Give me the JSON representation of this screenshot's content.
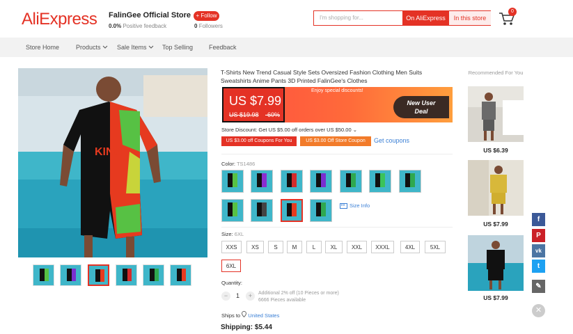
{
  "header": {
    "logo": "AliExpress",
    "store_name": "FalinGee Official Store",
    "store_name_chevron": "⌄",
    "feedback_value": "0.0%",
    "feedback_label": "Positive feedback",
    "follow_label": "+ Follow",
    "followers_value": "0",
    "followers_label": "Followers",
    "search_placeholder": "I'm shopping for...",
    "search_ali_label": "On AliExpress",
    "search_store_label": "In this store",
    "cart_count": "0"
  },
  "nav": {
    "items": [
      "Store Home",
      "Products",
      "Sale Items",
      "Top Selling",
      "Feedback"
    ]
  },
  "product": {
    "title": "T-Shirts New Trend Casual Style Sets Oversized Fashion Clothing Men Suits Sweatshirts Anime Pants 3D Printed FalinGee's Clothes",
    "price_now": "US $7.99",
    "price_old": "US $19.98",
    "discount": "-60%",
    "promo_text": "Enjoy special discounts!",
    "new_user_line1": "New User",
    "new_user_line2": "Deal",
    "store_discount": "Store Discount: Get US $5.00 off orders over US $50.00 ⌄",
    "coupon1": "US $3.00 off Coupons For You",
    "coupon2": "US $3.00 Off Store Coupon",
    "get_coupons": "Get coupons",
    "color_label": "Color:",
    "color_value": "TS1486",
    "size_info": "Size Info",
    "size_label": "Size:",
    "size_value": "6XL",
    "sizes": [
      "XXS",
      "XS",
      "S",
      "M",
      "L",
      "XL",
      "XXL",
      "XXXL",
      "4XL",
      "5XL",
      "6XL"
    ],
    "quantity_label": "Quantity:",
    "quantity_minus": "−",
    "quantity_plus": "+",
    "quantity_value": "1",
    "quantity_note1": "Additional 2% off (10 Pieces or more)",
    "quantity_note2": "6666 Pieces available",
    "ships_label": "Ships to",
    "ships_location": "United States",
    "shipping": "Shipping: $5.44"
  },
  "recommended": {
    "title": "Recommended For You",
    "prices": [
      "US $6.39",
      "US $7.99",
      "US $7.99"
    ]
  },
  "social": {
    "facebook": "f",
    "pinterest": "P",
    "vk": "vk",
    "twitter": "t",
    "edit": "✎",
    "close": "✕"
  },
  "colors": {
    "brand": "#e43225",
    "link": "#3a7fd5",
    "facebook": "#3b5998",
    "pinterest": "#cb2027",
    "vk": "#4c75a3",
    "twitter": "#1da1f2"
  }
}
